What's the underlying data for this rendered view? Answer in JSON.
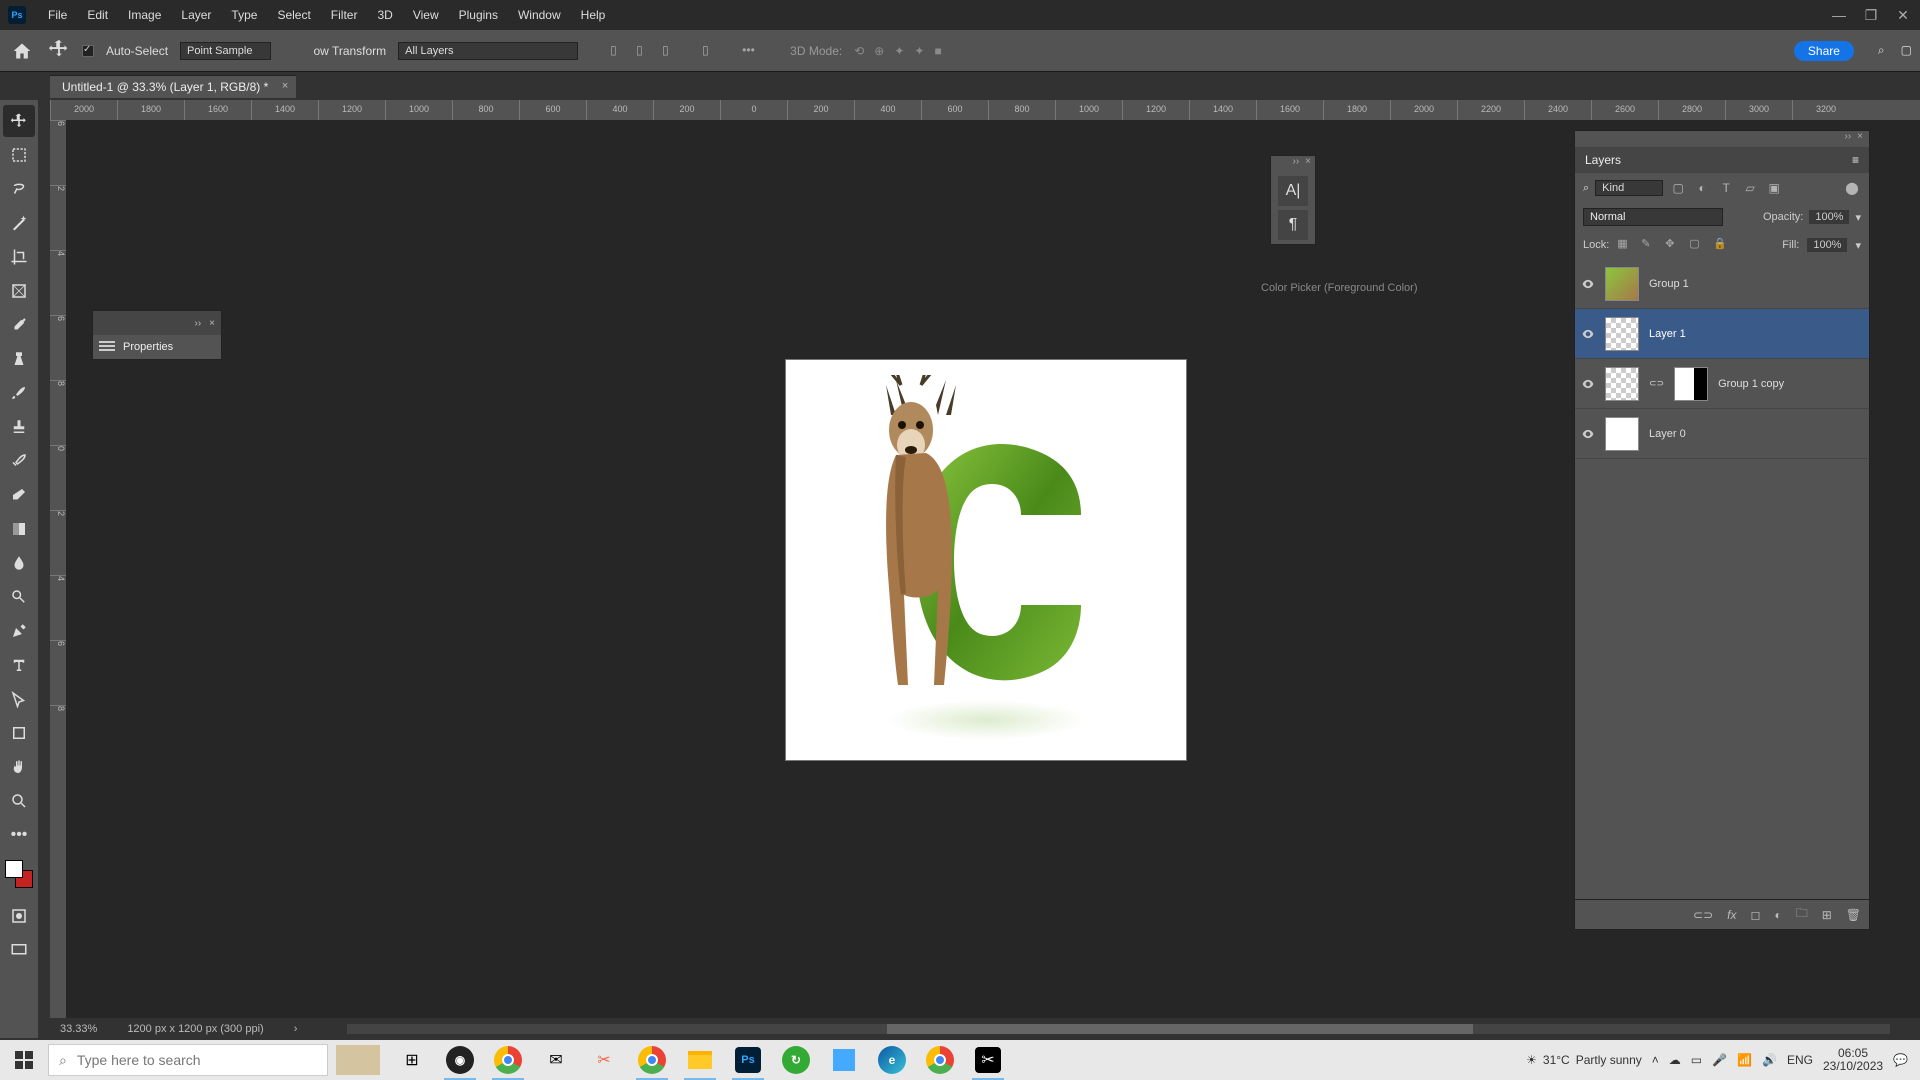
{
  "menubar": {
    "items": [
      "File",
      "Edit",
      "Image",
      "Layer",
      "Type",
      "Select",
      "Filter",
      "3D",
      "View",
      "Plugins",
      "Window",
      "Help"
    ]
  },
  "options": {
    "auto_select": "Auto-Select",
    "sample": "Point Sample",
    "transform": "ow Transform",
    "layers_mode": "All Layers",
    "mode3d": "3D Mode:",
    "share": "Share"
  },
  "document": {
    "tab_title": "Untitled-1 @ 33.3% (Layer 1, RGB/8) *"
  },
  "ruler_h": [
    "2000",
    "1800",
    "1600",
    "1400",
    "1200",
    "1000",
    "800",
    "600",
    "400",
    "200",
    "0",
    "200",
    "400",
    "600",
    "800",
    "1000",
    "1200",
    "1400",
    "1600",
    "1800",
    "2000",
    "2200",
    "2400",
    "2600",
    "2800",
    "3000",
    "3200"
  ],
  "ruler_v": [
    "6",
    "2",
    "4",
    "6",
    "8",
    "0",
    "2",
    "4",
    "6",
    "8"
  ],
  "panels": {
    "properties": "Properties",
    "picker_hint": "Color Picker (Foreground Color)"
  },
  "layers": {
    "title": "Layers",
    "kind": "Kind",
    "blend_mode": "Normal",
    "opacity_label": "Opacity:",
    "opacity_value": "100%",
    "lock_label": "Lock:",
    "fill_label": "Fill:",
    "fill_value": "100%",
    "items": [
      {
        "name": "Group 1",
        "selected": false,
        "thumb": "group1"
      },
      {
        "name": "Layer 1",
        "selected": true,
        "thumb": "checker"
      },
      {
        "name": "Group 1 copy",
        "selected": false,
        "thumb": "mask"
      },
      {
        "name": "Layer 0",
        "selected": false,
        "thumb": "white"
      }
    ]
  },
  "status": {
    "zoom": "33.33%",
    "dims": "1200 px x 1200 px (300 ppi)"
  },
  "taskbar": {
    "search_placeholder": "Type here to search",
    "weather_temp": "31°C",
    "weather_cond": "Partly sunny",
    "time": "06:05",
    "date": "23/10/2023"
  }
}
